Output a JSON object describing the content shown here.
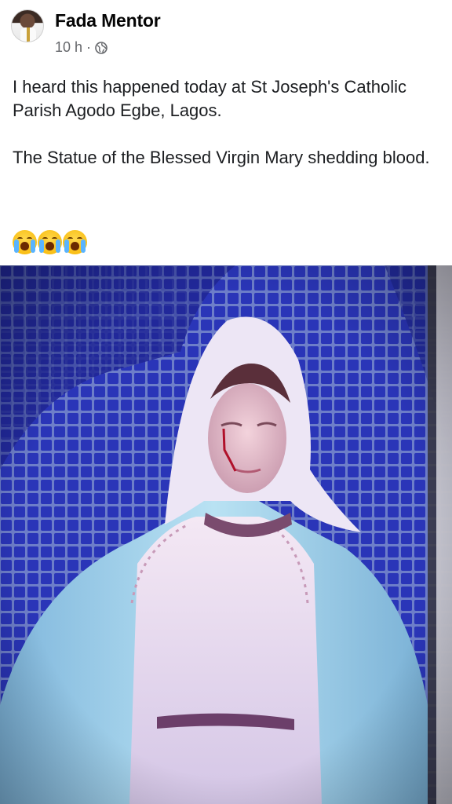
{
  "post": {
    "author": "Fada Mentor",
    "time": "10 h",
    "separator": "·",
    "privacy_icon": "globe-icon",
    "paragraph_1": "I heard this happened today at St Joseph's Catholic Parish Agodo Egbe, Lagos.",
    "paragraph_2": "The Statue of the Blessed Virgin Mary shedding blood.",
    "emoji_icon": "crying-face-icon",
    "emoji_count": 3
  },
  "colors": {
    "name": "#050505",
    "meta": "#65676b",
    "text": "#1c1e21",
    "tile_blue": "#2f2fb8",
    "veil": "#f2eef8",
    "mantle": "#9fd0ea"
  }
}
